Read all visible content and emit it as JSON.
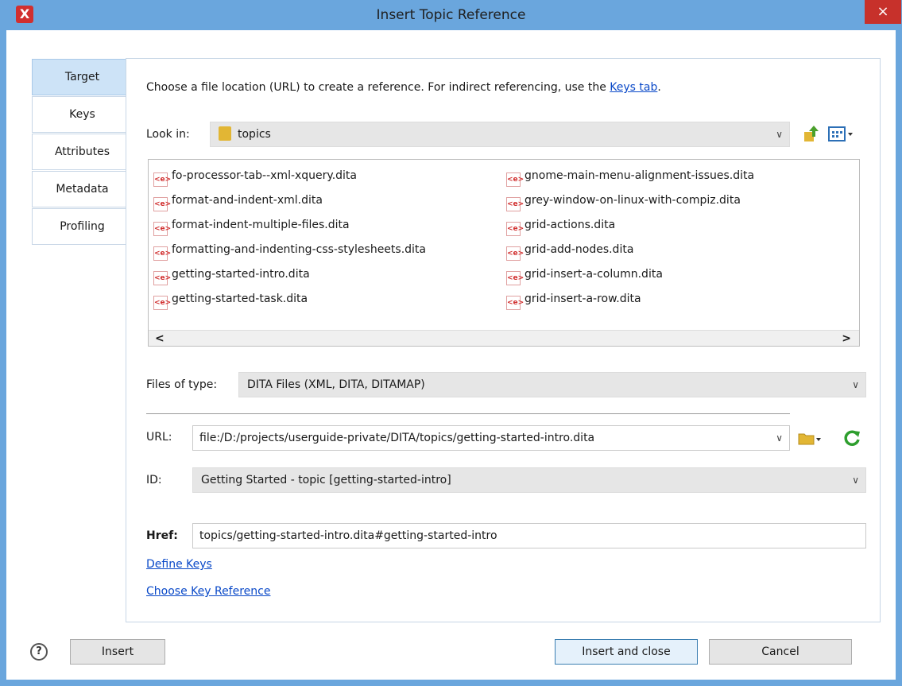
{
  "window": {
    "title": "Insert Topic Reference",
    "app_icon": "X",
    "close_icon": "×"
  },
  "tabs": [
    {
      "label": "Target",
      "active": true
    },
    {
      "label": "Keys",
      "active": false
    },
    {
      "label": "Attributes",
      "active": false
    },
    {
      "label": "Metadata",
      "active": false
    },
    {
      "label": "Profiling",
      "active": false
    }
  ],
  "instructions": {
    "text": "Choose a file location (URL) to create a reference. For indirect referencing, use the ",
    "link": "Keys tab",
    "suffix": "."
  },
  "look_in": {
    "label": "Look in:",
    "value": "topics",
    "chevron": "∨"
  },
  "files": [
    "fo-processor-tab--xml-xquery.dita",
    "format-and-indent-xml.dita",
    "format-indent-multiple-files.dita",
    "formatting-and-indenting-css-stylesheets.dita",
    "getting-started-intro.dita",
    "getting-started-task.dita",
    "gnome-main-menu-alignment-issues.dita",
    "grey-window-on-linux-with-compiz.dita",
    "grid-actions.dita",
    "grid-add-nodes.dita",
    "grid-insert-a-column.dita",
    "grid-insert-a-row.dita"
  ],
  "file_icon_glyph": "<e>",
  "scroll": {
    "left": "<",
    "right": ">"
  },
  "files_of_type": {
    "label": "Files of type:",
    "value": "DITA Files (XML, DITA, DITAMAP)",
    "chevron": "∨"
  },
  "url": {
    "label": "URL:",
    "value": "file:/D:/projects/userguide-private/DITA/topics/getting-started-intro.dita",
    "chevron": "∨"
  },
  "id": {
    "label": "ID:",
    "value": "Getting Started - topic [getting-started-intro]",
    "chevron": "∨"
  },
  "href": {
    "label": "Href:",
    "value": "topics/getting-started-intro.dita#getting-started-intro"
  },
  "links": {
    "define_keys": "Define Keys",
    "choose_key_reference": "Choose Key Reference"
  },
  "buttons": {
    "help": "?",
    "insert": "Insert",
    "insert_and_close": "Insert and close",
    "cancel": "Cancel"
  },
  "colors": {
    "window_frame": "#6aa6dd",
    "close_button": "#c7312b",
    "active_tab": "#cde3f7",
    "link": "#0a49c8",
    "refresh_icon": "#2e9e2e",
    "folder_icon": "#e2b634"
  }
}
